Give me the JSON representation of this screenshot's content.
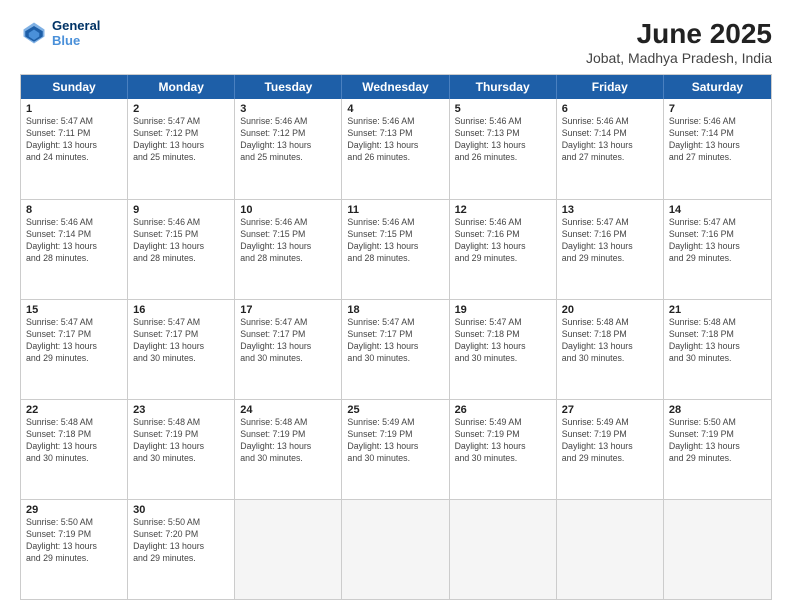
{
  "header": {
    "logo_line1": "General",
    "logo_line2": "Blue",
    "title": "June 2025",
    "subtitle": "Jobat, Madhya Pradesh, India"
  },
  "weekdays": [
    "Sunday",
    "Monday",
    "Tuesday",
    "Wednesday",
    "Thursday",
    "Friday",
    "Saturday"
  ],
  "rows": [
    [
      {
        "day": "",
        "empty": true
      },
      {
        "day": "",
        "empty": true
      },
      {
        "day": "",
        "empty": true
      },
      {
        "day": "",
        "empty": true
      },
      {
        "day": "",
        "empty": true
      },
      {
        "day": "",
        "empty": true
      },
      {
        "day": "",
        "empty": true
      }
    ],
    [
      {
        "day": "1",
        "info": "Sunrise: 5:47 AM\nSunset: 7:11 PM\nDaylight: 13 hours\nand 24 minutes."
      },
      {
        "day": "2",
        "info": "Sunrise: 5:47 AM\nSunset: 7:12 PM\nDaylight: 13 hours\nand 25 minutes."
      },
      {
        "day": "3",
        "info": "Sunrise: 5:46 AM\nSunset: 7:12 PM\nDaylight: 13 hours\nand 25 minutes."
      },
      {
        "day": "4",
        "info": "Sunrise: 5:46 AM\nSunset: 7:13 PM\nDaylight: 13 hours\nand 26 minutes."
      },
      {
        "day": "5",
        "info": "Sunrise: 5:46 AM\nSunset: 7:13 PM\nDaylight: 13 hours\nand 26 minutes."
      },
      {
        "day": "6",
        "info": "Sunrise: 5:46 AM\nSunset: 7:14 PM\nDaylight: 13 hours\nand 27 minutes."
      },
      {
        "day": "7",
        "info": "Sunrise: 5:46 AM\nSunset: 7:14 PM\nDaylight: 13 hours\nand 27 minutes."
      }
    ],
    [
      {
        "day": "8",
        "info": "Sunrise: 5:46 AM\nSunset: 7:14 PM\nDaylight: 13 hours\nand 28 minutes."
      },
      {
        "day": "9",
        "info": "Sunrise: 5:46 AM\nSunset: 7:15 PM\nDaylight: 13 hours\nand 28 minutes."
      },
      {
        "day": "10",
        "info": "Sunrise: 5:46 AM\nSunset: 7:15 PM\nDaylight: 13 hours\nand 28 minutes."
      },
      {
        "day": "11",
        "info": "Sunrise: 5:46 AM\nSunset: 7:15 PM\nDaylight: 13 hours\nand 28 minutes."
      },
      {
        "day": "12",
        "info": "Sunrise: 5:46 AM\nSunset: 7:16 PM\nDaylight: 13 hours\nand 29 minutes."
      },
      {
        "day": "13",
        "info": "Sunrise: 5:47 AM\nSunset: 7:16 PM\nDaylight: 13 hours\nand 29 minutes."
      },
      {
        "day": "14",
        "info": "Sunrise: 5:47 AM\nSunset: 7:16 PM\nDaylight: 13 hours\nand 29 minutes."
      }
    ],
    [
      {
        "day": "15",
        "info": "Sunrise: 5:47 AM\nSunset: 7:17 PM\nDaylight: 13 hours\nand 29 minutes."
      },
      {
        "day": "16",
        "info": "Sunrise: 5:47 AM\nSunset: 7:17 PM\nDaylight: 13 hours\nand 30 minutes."
      },
      {
        "day": "17",
        "info": "Sunrise: 5:47 AM\nSunset: 7:17 PM\nDaylight: 13 hours\nand 30 minutes."
      },
      {
        "day": "18",
        "info": "Sunrise: 5:47 AM\nSunset: 7:17 PM\nDaylight: 13 hours\nand 30 minutes."
      },
      {
        "day": "19",
        "info": "Sunrise: 5:47 AM\nSunset: 7:18 PM\nDaylight: 13 hours\nand 30 minutes."
      },
      {
        "day": "20",
        "info": "Sunrise: 5:48 AM\nSunset: 7:18 PM\nDaylight: 13 hours\nand 30 minutes."
      },
      {
        "day": "21",
        "info": "Sunrise: 5:48 AM\nSunset: 7:18 PM\nDaylight: 13 hours\nand 30 minutes."
      }
    ],
    [
      {
        "day": "22",
        "info": "Sunrise: 5:48 AM\nSunset: 7:18 PM\nDaylight: 13 hours\nand 30 minutes."
      },
      {
        "day": "23",
        "info": "Sunrise: 5:48 AM\nSunset: 7:19 PM\nDaylight: 13 hours\nand 30 minutes."
      },
      {
        "day": "24",
        "info": "Sunrise: 5:48 AM\nSunset: 7:19 PM\nDaylight: 13 hours\nand 30 minutes."
      },
      {
        "day": "25",
        "info": "Sunrise: 5:49 AM\nSunset: 7:19 PM\nDaylight: 13 hours\nand 30 minutes."
      },
      {
        "day": "26",
        "info": "Sunrise: 5:49 AM\nSunset: 7:19 PM\nDaylight: 13 hours\nand 30 minutes."
      },
      {
        "day": "27",
        "info": "Sunrise: 5:49 AM\nSunset: 7:19 PM\nDaylight: 13 hours\nand 29 minutes."
      },
      {
        "day": "28",
        "info": "Sunrise: 5:50 AM\nSunset: 7:19 PM\nDaylight: 13 hours\nand 29 minutes."
      }
    ],
    [
      {
        "day": "29",
        "info": "Sunrise: 5:50 AM\nSunset: 7:19 PM\nDaylight: 13 hours\nand 29 minutes."
      },
      {
        "day": "30",
        "info": "Sunrise: 5:50 AM\nSunset: 7:20 PM\nDaylight: 13 hours\nand 29 minutes."
      },
      {
        "day": "",
        "empty": true
      },
      {
        "day": "",
        "empty": true
      },
      {
        "day": "",
        "empty": true
      },
      {
        "day": "",
        "empty": true
      },
      {
        "day": "",
        "empty": true
      }
    ]
  ]
}
